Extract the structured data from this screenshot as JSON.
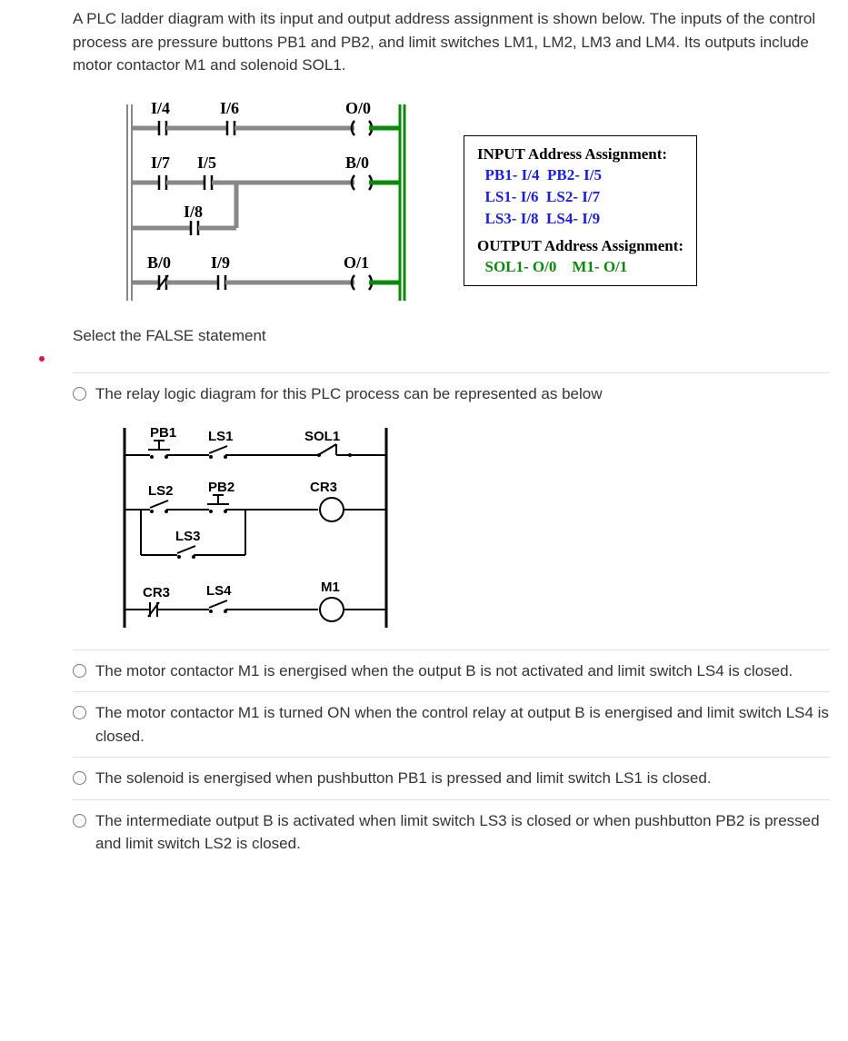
{
  "question": {
    "p1": "A PLC ladder diagram with its input and output address assignment is shown below. The inputs of the control process are pressure buttons PB1 and PB2, and limit switches LM1, LM2, LM3 and LM4. Its outputs include motor contactor M1 and solenoid SOL1.",
    "select": "Select the FALSE statement"
  },
  "ladder": {
    "r1": {
      "c1": "I/4",
      "c2": "I/6",
      "out": "O/0"
    },
    "r2": {
      "c1": "I/7",
      "c2": "I/5",
      "out": "B/0"
    },
    "r3": {
      "c1": "I/8"
    },
    "r4": {
      "c1": "B/0",
      "c2": "I/9",
      "out": "O/1"
    }
  },
  "assign": {
    "h1": "INPUT Address Assignment:",
    "l1a": "PB1- I/4",
    "l1b": "PB2- I/5",
    "l2a": "LS1- I/6",
    "l2b": "LS2- I/7",
    "l3a": "LS3- I/8",
    "l3b": "LS4- I/9",
    "h2": "OUTPUT Address Assignment:",
    "l4a": "SOL1- O/0",
    "l4b": "M1- O/1"
  },
  "options": {
    "a_text": "The relay logic diagram for this PLC process can be represented as below",
    "b_text": "The motor contactor M1 is energised when the output B is not activated and limit switch LS4 is closed.",
    "c_text": "The motor contactor M1 is turned ON when the control relay at output B is energised and limit switch LS4 is closed.",
    "d_text": "The solenoid is energised when pushbutton PB1 is pressed and limit switch LS1 is closed.",
    "e_text": "The intermediate output B is activated when limit switch LS3 is closed or when pushbutton PB2 is pressed and limit switch LS2 is closed."
  },
  "relay": {
    "r1": {
      "c1": "PB1",
      "c2": "LS1",
      "out": "SOL1"
    },
    "r2": {
      "c1": "LS2",
      "c2": "PB2",
      "out": "CR3"
    },
    "r3": {
      "c1": "LS3"
    },
    "r4": {
      "c1": "CR3",
      "c2": "LS4",
      "out": "M1"
    }
  }
}
